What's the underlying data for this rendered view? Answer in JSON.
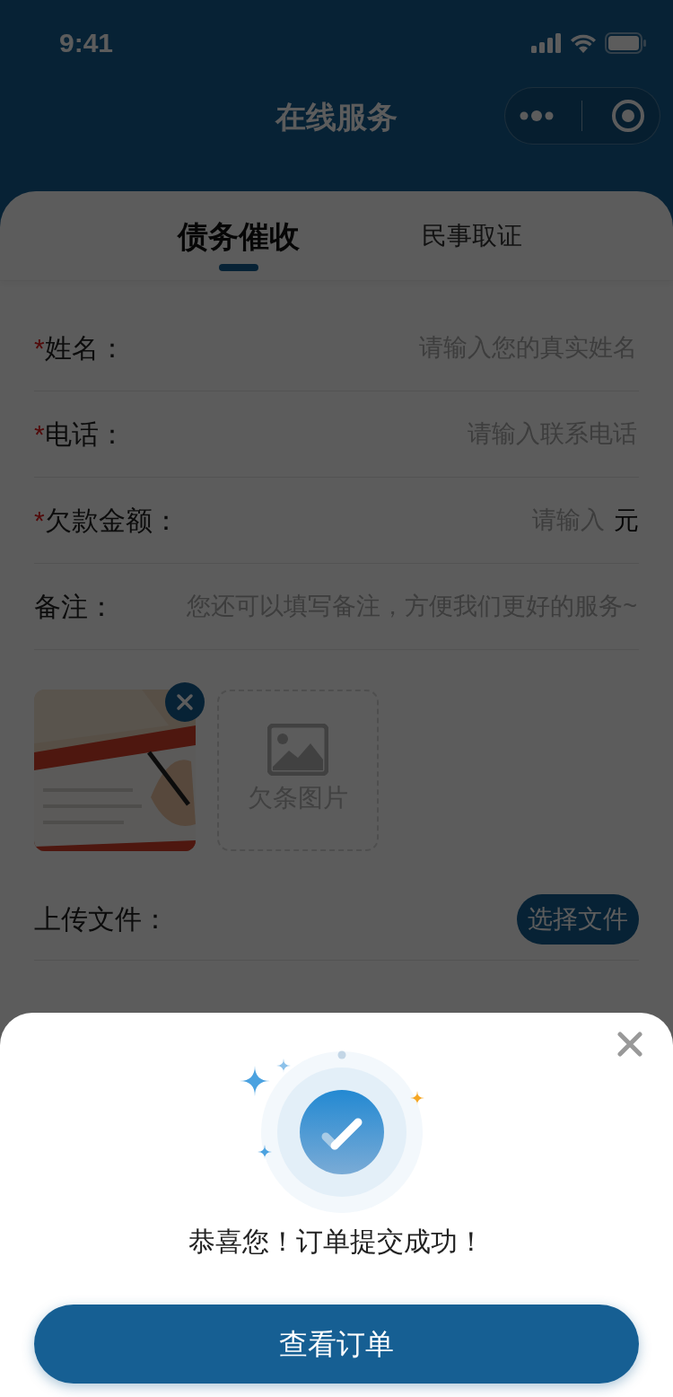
{
  "status_bar": {
    "time": "9:41"
  },
  "nav_bar": {
    "title": "在线服务"
  },
  "tabs": [
    {
      "label": "债务催收",
      "selected": true
    },
    {
      "label": "民事取证",
      "selected": false
    }
  ],
  "form": {
    "fields": [
      {
        "required_mark": "*",
        "label": "姓名：",
        "placeholder": "请输入您的真实姓名"
      },
      {
        "required_mark": "*",
        "label": "电话：",
        "placeholder": "请输入联系电话"
      },
      {
        "required_mark": "*",
        "label": "欠款金额：",
        "placeholder": "请输入",
        "unit": "元"
      },
      {
        "label": "备注：",
        "placeholder": "您还可以填写备注，方便我们更好的服务~"
      }
    ],
    "images": [
      {
        "kind": "picture"
      },
      {
        "kind": "add",
        "label": "欠条图片"
      }
    ],
    "upload": {
      "label": "上传文件：",
      "button": "选择文件"
    }
  },
  "dialog": {
    "message": "恭喜您！订单提交成功！",
    "button": "查看订单"
  }
}
